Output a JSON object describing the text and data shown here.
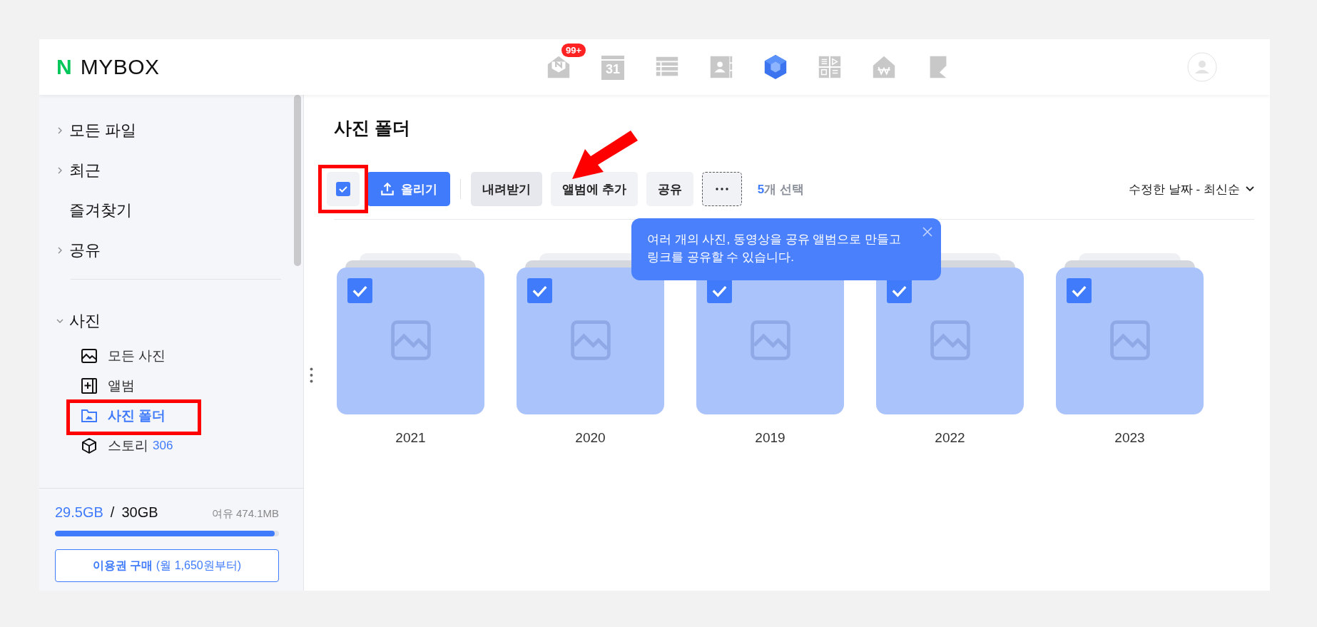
{
  "header": {
    "logo_mark": "N",
    "logo_text": "MYBOX",
    "apps": [
      {
        "kind": "mail",
        "selected": false,
        "badge": "99+"
      },
      {
        "kind": "calendar",
        "selected": false,
        "label": "31"
      },
      {
        "kind": "list",
        "selected": false
      },
      {
        "kind": "contacts",
        "selected": false
      },
      {
        "kind": "cube",
        "selected": true
      },
      {
        "kind": "grid",
        "selected": false
      },
      {
        "kind": "house",
        "selected": false
      },
      {
        "kind": "flag",
        "selected": false
      }
    ]
  },
  "sidebar": {
    "items": [
      {
        "label": "모든 파일",
        "expandable": true
      },
      {
        "label": "최근",
        "expandable": true
      },
      {
        "label": "즐겨찾기",
        "expandable": false
      },
      {
        "label": "공유",
        "expandable": true
      }
    ],
    "photo_section": {
      "label": "사진",
      "expanded": true,
      "children": [
        {
          "kind": "image",
          "label": "모든 사진",
          "selected": false,
          "highlighted": false
        },
        {
          "kind": "album",
          "label": "앨범",
          "selected": false,
          "highlighted": false
        },
        {
          "kind": "folder",
          "label": "사진 폴더",
          "selected": true,
          "highlighted": true
        },
        {
          "kind": "box",
          "label": "스토리",
          "count": "306",
          "selected": false,
          "highlighted": false
        }
      ]
    },
    "storage": {
      "used": "29.5GB",
      "separator": "/",
      "total": "30GB",
      "free": "여유 474.1MB",
      "level": 0.98
    },
    "purchase_button": "**이용권 구매** (월 1,650원부터)"
  },
  "main": {
    "title": "사진 폴더",
    "select_all": {
      "checked": true,
      "highlighted": true
    },
    "buttons": [
      {
        "kind": "primary",
        "label": "올리기"
      },
      {
        "kind": "secondary",
        "label": "내려받기"
      },
      {
        "kind": "secondary",
        "label": "앨범에 추가"
      },
      {
        "kind": "secondary",
        "label": "공유"
      },
      {
        "kind": "more"
      }
    ],
    "selection_count": "5",
    "selection_label": "개 선택",
    "sort": "수정한 날짜 - 최신순",
    "tooltip": "여러 개의 사진, 동영상을 공유 앨범으로 만들고\n링크를 공유할 수 있습니다.",
    "folders": [
      {
        "name": "2021",
        "checked": true
      },
      {
        "name": "2020",
        "checked": true
      },
      {
        "name": "2019",
        "checked": true
      },
      {
        "name": "2022",
        "checked": true
      },
      {
        "name": "2023",
        "checked": true
      }
    ]
  }
}
